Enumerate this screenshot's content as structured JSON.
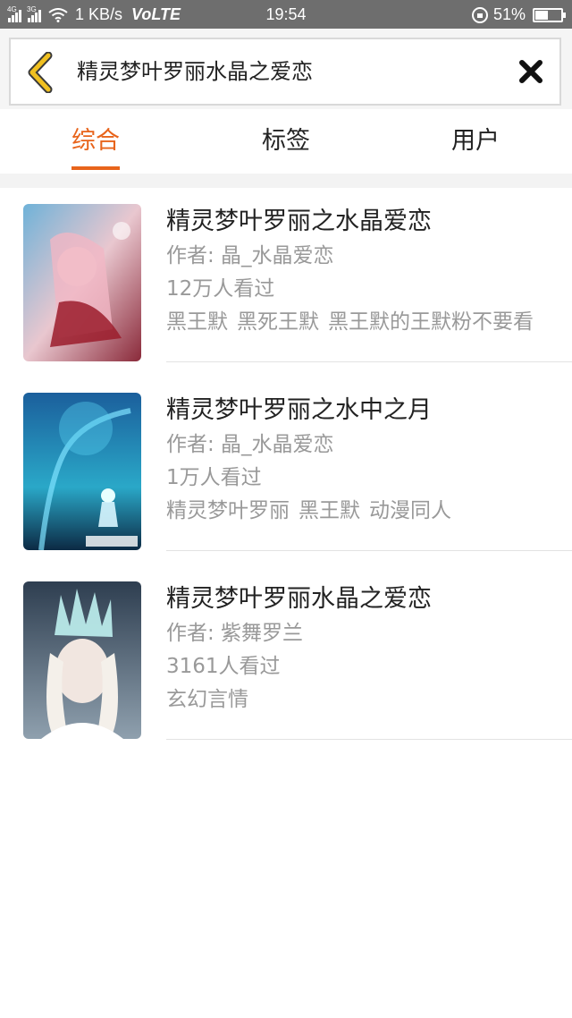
{
  "status_bar": {
    "network_a": "4G",
    "network_b": "3G",
    "speed": "1 KB/s",
    "volte": "VoLTE",
    "time": "19:54",
    "battery": "51%",
    "battery_level": 0.51
  },
  "search": {
    "query": "精灵梦叶罗丽水晶之爱恋",
    "back_icon": "chevron-left-icon",
    "clear_icon": "close-icon"
  },
  "tabs": [
    {
      "label": "综合",
      "active": true
    },
    {
      "label": "标签",
      "active": false
    },
    {
      "label": "用户",
      "active": false
    }
  ],
  "results": [
    {
      "title": "精灵梦叶罗丽之水晶爱恋",
      "author": "作者: 晶_水晶爱恋",
      "views": "12万人看过",
      "tags": [
        "黑王默",
        "黑死王默",
        "黑王默的王默粉不要看"
      ]
    },
    {
      "title": "精灵梦叶罗丽之水中之月",
      "author": "作者: 晶_水晶爱恋",
      "views": "1万人看过",
      "tags": [
        "精灵梦叶罗丽",
        "黑王默",
        "动漫同人"
      ]
    },
    {
      "title": "精灵梦叶罗丽水晶之爱恋",
      "author": "作者: 紫舞罗兰",
      "views": "3161人看过",
      "tags": [
        "玄幻言情"
      ]
    }
  ],
  "colors": {
    "accent": "#e8641b",
    "status_bar": "#6e6e6e",
    "back_icon": "#f0c020"
  }
}
